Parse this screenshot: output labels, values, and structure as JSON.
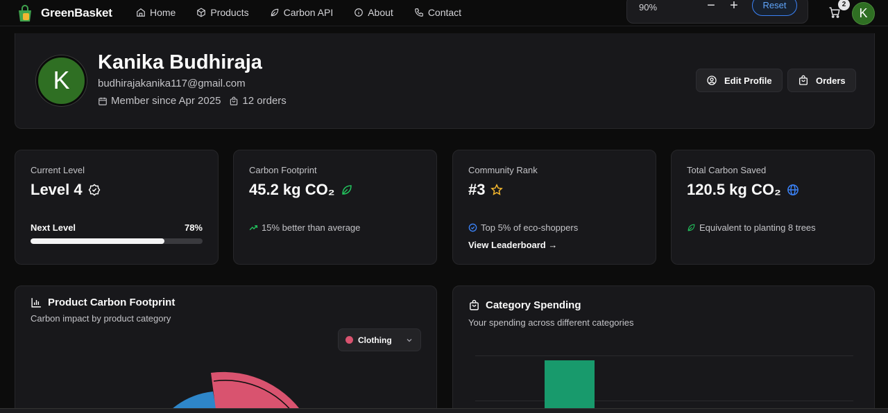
{
  "brand": {
    "name": "GreenBasket"
  },
  "nav": {
    "items": [
      {
        "label": "Home",
        "icon": "home-icon"
      },
      {
        "label": "Products",
        "icon": "box-icon"
      },
      {
        "label": "Carbon API",
        "icon": "leaf-icon"
      },
      {
        "label": "About",
        "icon": "info-icon"
      },
      {
        "label": "Contact",
        "icon": "phone-icon"
      }
    ],
    "zoom": {
      "value": "90%",
      "minus": "−",
      "plus": "+",
      "reset": "Reset"
    },
    "cart_count": "2",
    "avatar_initial": "K"
  },
  "profile": {
    "initial": "K",
    "name": "Kanika Budhiraja",
    "email": "budhirajakanika117@gmail.com",
    "member_since": "Member since Apr 2025",
    "orders_count": "12 orders",
    "edit_label": "Edit Profile",
    "orders_label": "Orders"
  },
  "stats": {
    "level": {
      "label": "Current Level",
      "value": "Level 4",
      "next_label": "Next Level",
      "progress_text": "78%",
      "progress": 0.78
    },
    "footprint": {
      "label": "Carbon Footprint",
      "value": "45.2 kg CO₂",
      "sub": "15% better than average"
    },
    "rank": {
      "label": "Community Rank",
      "value": "#3",
      "sub": "Top 5% of eco-shoppers",
      "link": "View Leaderboard →"
    },
    "saved": {
      "label": "Total Carbon Saved",
      "value": "120.5 kg CO₂",
      "sub": "Equivalent to planting 8 trees"
    }
  },
  "product_chart": {
    "title": "Product Carbon Footprint",
    "subtitle": "Carbon impact by product category",
    "selected_category": "Clothing"
  },
  "spending_chart": {
    "title": "Category Spending",
    "subtitle": "Your spending across different categories"
  },
  "colors": {
    "brand_green": "#2f6f23",
    "accent_blue": "#3b82f6",
    "leaf_green": "#22c55e",
    "star_gold": "#f5b82e",
    "clothing_pink": "#d9536f",
    "slice_blue": "#2e86c9",
    "bar_green": "#189a6c"
  }
}
